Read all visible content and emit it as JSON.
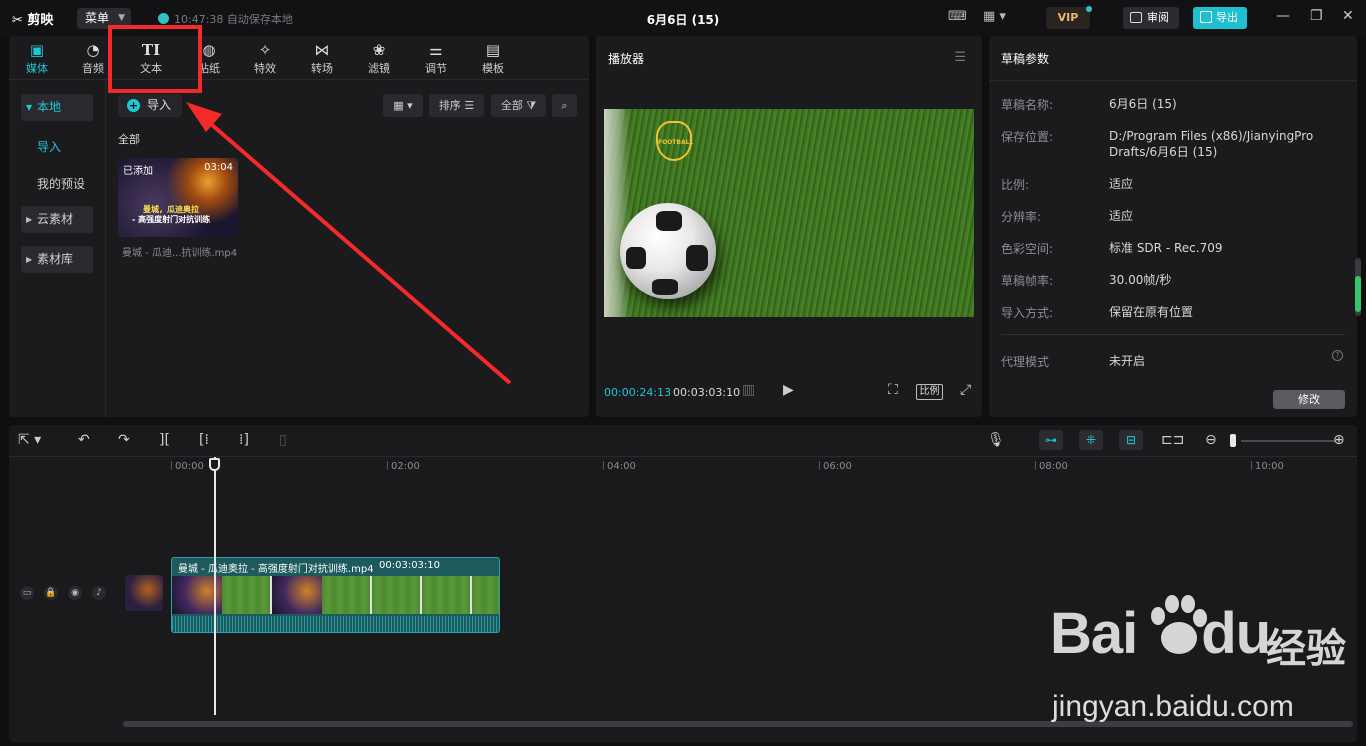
{
  "titlebar": {
    "app_name": "剪映",
    "menu_label": "菜单",
    "autosave": "10:47:38 自动保存本地",
    "project_title": "6月6日 (15)",
    "vip": "VIP",
    "review": "审阅",
    "export": "导出"
  },
  "media": {
    "tabs": [
      {
        "label": "媒体",
        "icon": "media-icon"
      },
      {
        "label": "音频",
        "icon": "audio-icon"
      },
      {
        "label": "文本",
        "icon": "text-icon"
      },
      {
        "label": "贴纸",
        "icon": "sticker-icon"
      },
      {
        "label": "特效",
        "icon": "effects-icon"
      },
      {
        "label": "转场",
        "icon": "transition-icon"
      },
      {
        "label": "滤镜",
        "icon": "filter-icon"
      },
      {
        "label": "调节",
        "icon": "adjust-icon"
      },
      {
        "label": "模板",
        "icon": "template-icon"
      }
    ],
    "sidebar": {
      "local": "本地",
      "import": "导入",
      "my_presets": "我的预设",
      "cloud": "云素材",
      "library": "素材库"
    },
    "import_button": "导入",
    "sort": "排序",
    "all_filter": "全部",
    "all_label": "全部",
    "thumb": {
      "added": "已添加",
      "duration": "03:04",
      "caption1": "曼城，瓜迪奥拉",
      "caption2": "- 高强度射门对抗训练"
    },
    "file_name": "曼城 - 瓜迪...抗训练.mp4"
  },
  "player": {
    "title": "播放器",
    "badge": "FOOTBALL",
    "current_time": "00:00:24:13",
    "total_time": "00:03:03:10",
    "ratio": "比例"
  },
  "draft": {
    "title": "草稿参数",
    "rows": [
      {
        "key": "草稿名称:",
        "value": "6月6日 (15)"
      },
      {
        "key": "保存位置:",
        "value": "D:/Program Files (x86)/JianyingPro Drafts/6月6日 (15)"
      },
      {
        "key": "比例:",
        "value": "适应"
      },
      {
        "key": "分辨率:",
        "value": "适应"
      },
      {
        "key": "色彩空间:",
        "value": "标准 SDR - Rec.709"
      },
      {
        "key": "草稿帧率:",
        "value": "30.00帧/秒"
      },
      {
        "key": "导入方式:",
        "value": "保留在原有位置"
      }
    ],
    "proxy_key": "代理模式",
    "proxy_value": "未开启",
    "edit_button": "修改"
  },
  "timeline": {
    "ticks": [
      "00:00",
      "02:00",
      "04:00",
      "06:00",
      "08:00",
      "10:00"
    ],
    "clip_name": "曼城 - 瓜迪奥拉 - 高强度射门对抗训练.mp4",
    "clip_duration": "00:03:03:10"
  },
  "watermark": {
    "brand": "Bai",
    "brand2": "du",
    "cn": "经验",
    "url": "jingyan.baidu.com"
  },
  "colors": {
    "accent": "#1fc6d4",
    "annotation": "#f22a2a"
  }
}
